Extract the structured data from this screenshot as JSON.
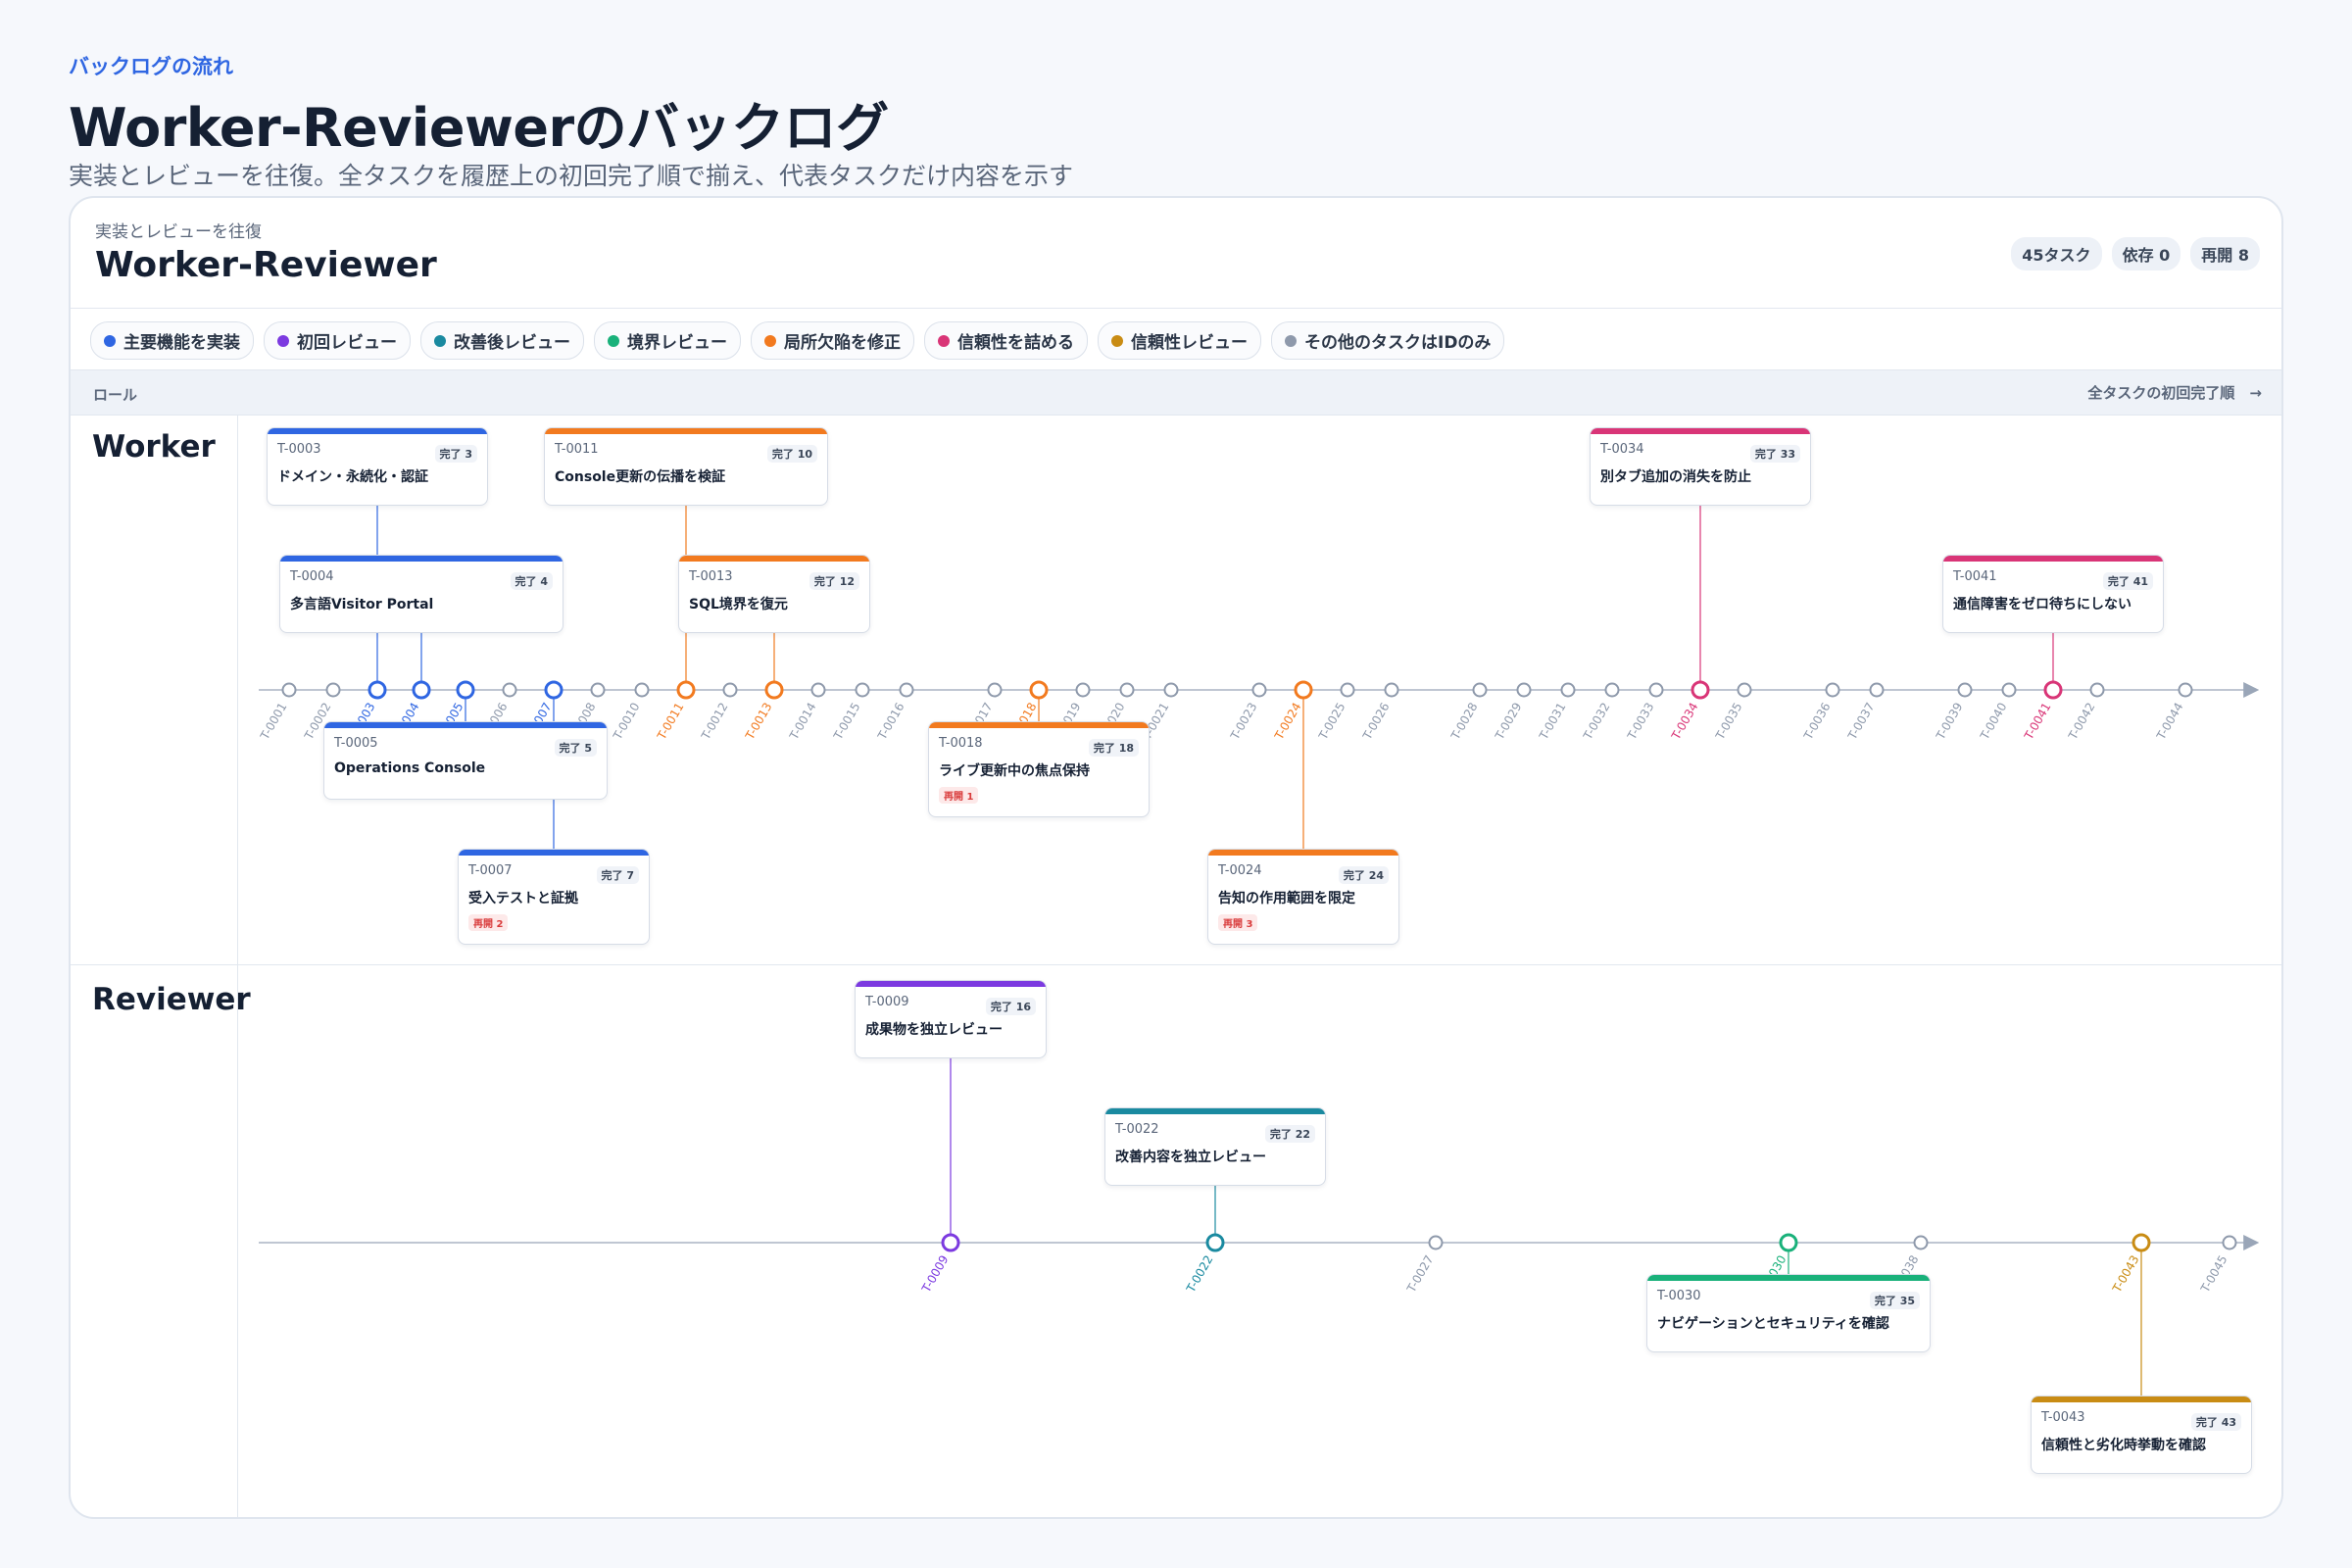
{
  "page": {
    "eyebrow": "バックログの流れ",
    "title": "Worker-Reviewerのバックログ",
    "subtitle": "実装とレビューを往復。全タスクを履歴上の初回完了順で揃え、代表タスクだけ内容を示す"
  },
  "card": {
    "eyebrow": "実装とレビューを往復",
    "title": "Worker-Reviewer",
    "chips": [
      "45タスク",
      "依存 0",
      "再開 8"
    ]
  },
  "legend": [
    {
      "key": "main",
      "label": "主要機能を実装",
      "color": "#2f66e2"
    },
    {
      "key": "first",
      "label": "初回レビュー",
      "color": "#7c3ae0"
    },
    {
      "key": "improve",
      "label": "改善後レビュー",
      "color": "#1a8aa0"
    },
    {
      "key": "boundary",
      "label": "境界レビュー",
      "color": "#19b17a"
    },
    {
      "key": "fix",
      "label": "局所欠陥を修正",
      "color": "#f27a1f"
    },
    {
      "key": "reliable",
      "label": "信頼性を詰める",
      "color": "#d93577"
    },
    {
      "key": "relreview",
      "label": "信頼性レビュー",
      "color": "#c98c14"
    },
    {
      "key": "other",
      "label": "その他のタスクはIDのみ",
      "color": "#8e99ab"
    }
  ],
  "header": {
    "role_label": "ロール",
    "order_label": "全タスクの初回完了順　→"
  },
  "lanes": [
    {
      "label": "Worker",
      "ticks": [
        {
          "id": "T-0001",
          "rank": 1,
          "cat": "other"
        },
        {
          "id": "T-0002",
          "rank": 2,
          "cat": "other"
        },
        {
          "id": "T-0003",
          "rank": 3,
          "cat": "main"
        },
        {
          "id": "T-0004",
          "rank": 4,
          "cat": "main"
        },
        {
          "id": "T-0005",
          "rank": 5,
          "cat": "main"
        },
        {
          "id": "T-0006",
          "rank": 6,
          "cat": "other"
        },
        {
          "id": "T-0007",
          "rank": 7,
          "cat": "main"
        },
        {
          "id": "T-0008",
          "rank": 8,
          "cat": "other"
        },
        {
          "id": "T-0010",
          "rank": 9,
          "cat": "other"
        },
        {
          "id": "T-0011",
          "rank": 10,
          "cat": "fix"
        },
        {
          "id": "T-0012",
          "rank": 11,
          "cat": "other"
        },
        {
          "id": "T-0013",
          "rank": 12,
          "cat": "fix"
        },
        {
          "id": "T-0014",
          "rank": 13,
          "cat": "other"
        },
        {
          "id": "T-0015",
          "rank": 14,
          "cat": "other"
        },
        {
          "id": "T-0016",
          "rank": 15,
          "cat": "other"
        },
        {
          "id": "T-0017",
          "rank": 17,
          "cat": "other"
        },
        {
          "id": "T-0018",
          "rank": 18,
          "cat": "fix"
        },
        {
          "id": "T-0019",
          "rank": 19,
          "cat": "other"
        },
        {
          "id": "T-0020",
          "rank": 20,
          "cat": "other"
        },
        {
          "id": "T-0021",
          "rank": 21,
          "cat": "other"
        },
        {
          "id": "T-0023",
          "rank": 23,
          "cat": "other"
        },
        {
          "id": "T-0024",
          "rank": 24,
          "cat": "fix"
        },
        {
          "id": "T-0025",
          "rank": 25,
          "cat": "other"
        },
        {
          "id": "T-0026",
          "rank": 26,
          "cat": "other"
        },
        {
          "id": "T-0028",
          "rank": 28,
          "cat": "other"
        },
        {
          "id": "T-0029",
          "rank": 29,
          "cat": "other"
        },
        {
          "id": "T-0031",
          "rank": 30,
          "cat": "other"
        },
        {
          "id": "T-0032",
          "rank": 31,
          "cat": "other"
        },
        {
          "id": "T-0033",
          "rank": 32,
          "cat": "other"
        },
        {
          "id": "T-0034",
          "rank": 33,
          "cat": "reliable"
        },
        {
          "id": "T-0035",
          "rank": 34,
          "cat": "other"
        },
        {
          "id": "T-0036",
          "rank": 36,
          "cat": "other"
        },
        {
          "id": "T-0037",
          "rank": 37,
          "cat": "other"
        },
        {
          "id": "T-0039",
          "rank": 39,
          "cat": "other"
        },
        {
          "id": "T-0040",
          "rank": 40,
          "cat": "other"
        },
        {
          "id": "T-0041",
          "rank": 41,
          "cat": "reliable"
        },
        {
          "id": "T-0042",
          "rank": 42,
          "cat": "other"
        },
        {
          "id": "T-0044",
          "rank": 44,
          "cat": "other"
        }
      ],
      "cards": [
        {
          "id": "T-0003",
          "rank": 3,
          "done": "完了 3",
          "title": "ドメイン・永続化・認証",
          "cat": "main",
          "pos": "above",
          "level": 0,
          "reopen": ""
        },
        {
          "id": "T-0004",
          "rank": 4,
          "done": "完了 4",
          "title": "多言語Visitor Portal",
          "cat": "main",
          "pos": "above",
          "level": 1,
          "reopen": ""
        },
        {
          "id": "T-0005",
          "rank": 5,
          "done": "完了 5",
          "title": "Operations Console",
          "cat": "main",
          "pos": "below",
          "level": 0,
          "reopen": ""
        },
        {
          "id": "T-0007",
          "rank": 7,
          "done": "完了 7",
          "title": "受入テストと証拠",
          "cat": "main",
          "pos": "below",
          "level": 1,
          "reopen": "再開 2"
        },
        {
          "id": "T-0011",
          "rank": 10,
          "done": "完了 10",
          "title": "Console更新の伝播を検証",
          "cat": "fix",
          "pos": "above",
          "level": 0,
          "reopen": ""
        },
        {
          "id": "T-0013",
          "rank": 12,
          "done": "完了 12",
          "title": "SQL境界を復元",
          "cat": "fix",
          "pos": "above",
          "level": 1,
          "reopen": ""
        },
        {
          "id": "T-0018",
          "rank": 18,
          "done": "完了 18",
          "title": "ライブ更新中の焦点保持",
          "cat": "fix",
          "pos": "below",
          "level": 0,
          "reopen": "再開 1"
        },
        {
          "id": "T-0024",
          "rank": 24,
          "done": "完了 24",
          "title": "告知の作用範囲を限定",
          "cat": "fix",
          "pos": "below",
          "level": 1,
          "reopen": "再開 3"
        },
        {
          "id": "T-0034",
          "rank": 33,
          "done": "完了 33",
          "title": "別タブ追加の消失を防止",
          "cat": "reliable",
          "pos": "above",
          "level": 0,
          "reopen": ""
        },
        {
          "id": "T-0041",
          "rank": 41,
          "done": "完了 41",
          "title": "通信障害をゼロ待ちにしない",
          "cat": "reliable",
          "pos": "above",
          "level": 1,
          "reopen": ""
        }
      ]
    },
    {
      "label": "Reviewer",
      "ticks": [
        {
          "id": "T-0009",
          "rank": 16,
          "cat": "first"
        },
        {
          "id": "T-0022",
          "rank": 22,
          "cat": "improve"
        },
        {
          "id": "T-0027",
          "rank": 27,
          "cat": "other"
        },
        {
          "id": "T-0030",
          "rank": 35,
          "cat": "boundary"
        },
        {
          "id": "T-0038",
          "rank": 38,
          "cat": "other"
        },
        {
          "id": "T-0043",
          "rank": 43,
          "cat": "relreview"
        },
        {
          "id": "T-0045",
          "rank": 45,
          "cat": "other"
        }
      ],
      "cards": [
        {
          "id": "T-0009",
          "rank": 16,
          "done": "完了 16",
          "title": "成果物を独立レビュー",
          "cat": "first",
          "pos": "above",
          "level": 0,
          "reopen": ""
        },
        {
          "id": "T-0022",
          "rank": 22,
          "done": "完了 22",
          "title": "改善内容を独立レビュー",
          "cat": "improve",
          "pos": "above",
          "level": 1,
          "reopen": ""
        },
        {
          "id": "T-0030",
          "rank": 35,
          "done": "完了 35",
          "title": "ナビゲーションとセキュリティを確認",
          "cat": "boundary",
          "pos": "below",
          "level": 0,
          "reopen": ""
        },
        {
          "id": "T-0043",
          "rank": 43,
          "done": "完了 43",
          "title": "信頼性と劣化時挙動を確認",
          "cat": "relreview",
          "pos": "below",
          "level": 1,
          "reopen": ""
        }
      ]
    }
  ]
}
